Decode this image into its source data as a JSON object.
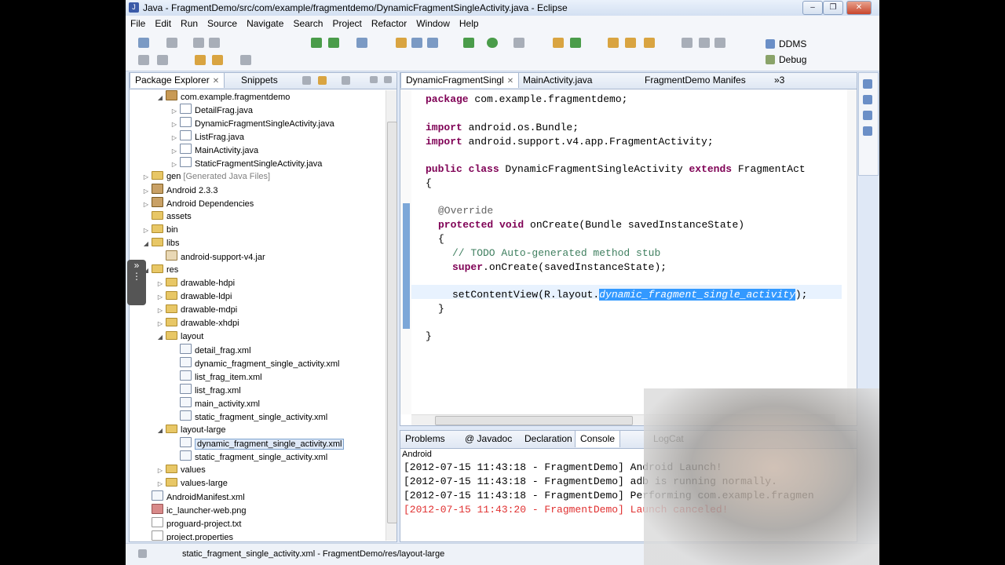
{
  "window": {
    "title": "Java - FragmentDemo/src/com/example/fragmentdemo/DynamicFragmentSingleActivity.java - Eclipse"
  },
  "menu": [
    "File",
    "Edit",
    "Run",
    "Source",
    "Navigate",
    "Search",
    "Project",
    "Refactor",
    "Window",
    "Help"
  ],
  "perspectives": {
    "ddms": "DDMS",
    "debug": "Debug"
  },
  "package_explorer": {
    "tab_label": "Package Explorer",
    "snippets_label": "Snippets",
    "tree": [
      {
        "label": "com.example.fragmentdemo",
        "type": "pkg",
        "arrow": "open",
        "depth": 2
      },
      {
        "label": "DetailFrag.java",
        "type": "java",
        "arrow": "closed",
        "depth": 3
      },
      {
        "label": "DynamicFragmentSingleActivity.java",
        "type": "java",
        "arrow": "closed",
        "depth": 3
      },
      {
        "label": "ListFrag.java",
        "type": "java",
        "arrow": "closed",
        "depth": 3
      },
      {
        "label": "MainActivity.java",
        "type": "java",
        "arrow": "closed",
        "depth": 3
      },
      {
        "label": "StaticFragmentSingleActivity.java",
        "type": "java",
        "arrow": "closed",
        "depth": 3
      },
      {
        "label": "gen",
        "extra": "[Generated Java Files]",
        "type": "folder",
        "arrow": "closed",
        "depth": 1
      },
      {
        "label": "Android 2.3.3",
        "type": "lib",
        "arrow": "closed",
        "depth": 1
      },
      {
        "label": "Android Dependencies",
        "type": "lib",
        "arrow": "closed",
        "depth": 1
      },
      {
        "label": "assets",
        "type": "folder",
        "arrow": "none",
        "depth": 1
      },
      {
        "label": "bin",
        "type": "folder",
        "arrow": "closed",
        "depth": 1
      },
      {
        "label": "libs",
        "type": "folder",
        "arrow": "open",
        "depth": 1
      },
      {
        "label": "android-support-v4.jar",
        "type": "jar",
        "arrow": "none",
        "depth": 2
      },
      {
        "label": "res",
        "type": "folder",
        "arrow": "open",
        "depth": 1
      },
      {
        "label": "drawable-hdpi",
        "type": "folder",
        "arrow": "closed",
        "depth": 2
      },
      {
        "label": "drawable-ldpi",
        "type": "folder",
        "arrow": "closed",
        "depth": 2
      },
      {
        "label": "drawable-mdpi",
        "type": "folder",
        "arrow": "closed",
        "depth": 2
      },
      {
        "label": "drawable-xhdpi",
        "type": "folder",
        "arrow": "closed",
        "depth": 2
      },
      {
        "label": "layout",
        "type": "folder",
        "arrow": "open",
        "depth": 2
      },
      {
        "label": "detail_frag.xml",
        "type": "xml",
        "arrow": "none",
        "depth": 3
      },
      {
        "label": "dynamic_fragment_single_activity.xml",
        "type": "xml",
        "arrow": "none",
        "depth": 3
      },
      {
        "label": "list_frag_item.xml",
        "type": "xml",
        "arrow": "none",
        "depth": 3
      },
      {
        "label": "list_frag.xml",
        "type": "xml",
        "arrow": "none",
        "depth": 3
      },
      {
        "label": "main_activity.xml",
        "type": "xml",
        "arrow": "none",
        "depth": 3
      },
      {
        "label": "static_fragment_single_activity.xml",
        "type": "xml",
        "arrow": "none",
        "depth": 3
      },
      {
        "label": "layout-large",
        "type": "folder",
        "arrow": "open",
        "depth": 2
      },
      {
        "label": "dynamic_fragment_single_activity.xml",
        "type": "xml",
        "arrow": "none",
        "depth": 3,
        "selected": true
      },
      {
        "label": "static_fragment_single_activity.xml",
        "type": "xml",
        "arrow": "none",
        "depth": 3
      },
      {
        "label": "values",
        "type": "folder",
        "arrow": "closed",
        "depth": 2
      },
      {
        "label": "values-large",
        "type": "folder",
        "arrow": "closed",
        "depth": 2
      },
      {
        "label": "AndroidManifest.xml",
        "type": "xml",
        "arrow": "none",
        "depth": 1
      },
      {
        "label": "ic_launcher-web.png",
        "type": "png",
        "arrow": "none",
        "depth": 1
      },
      {
        "label": "proguard-project.txt",
        "type": "file",
        "arrow": "none",
        "depth": 1
      },
      {
        "label": "project.properties",
        "type": "file",
        "arrow": "none",
        "depth": 1
      }
    ]
  },
  "editor": {
    "tabs": [
      {
        "label": "DynamicFragmentSingl",
        "active": true,
        "close": true
      },
      {
        "label": "MainActivity.java",
        "active": false
      },
      {
        "label": "FragmentDemo Manifes",
        "active": false
      },
      {
        "label": "»3",
        "active": false
      }
    ],
    "code": {
      "l1_kw": "package",
      "l1": " com.example.fragmentdemo;",
      "l2_kw": "import",
      "l2": " android.os.Bundle;",
      "l3_kw": "import",
      "l3": " android.support.v4.app.FragmentActivity;",
      "l4_kw1": "public class",
      "l4_a": " DynamicFragmentSingleActivity ",
      "l4_kw2": "extends",
      "l4_b": " FragmentAct",
      "l5": "{",
      "l6": "@Override",
      "l7_kw": "protected void",
      "l7": " onCreate(Bundle savedInstanceState)",
      "l8": "{",
      "l9_cm": "// TODO Auto-generated method stub",
      "l10_kw": "super",
      "l10": ".onCreate(savedInstanceState);",
      "l11_a": "setContentView(R.layout.",
      "l11_hl": "dynamic_fragment_single_activity",
      "l11_b": ");",
      "l12": "}",
      "l13": "}"
    }
  },
  "console": {
    "tabs": [
      "Problems",
      "@ Javadoc",
      "Declaration",
      "Console",
      "LogCat"
    ],
    "sub": "Android",
    "lines": [
      {
        "text": "[2012-07-15 11:43:18 - FragmentDemo] Android Launch!",
        "error": false
      },
      {
        "text": "[2012-07-15 11:43:18 - FragmentDemo] adb is running normally.",
        "error": false
      },
      {
        "text": "[2012-07-15 11:43:18 - FragmentDemo] Performing com.example.fragmen",
        "error": false
      },
      {
        "text": "[2012-07-15 11:43:20 - FragmentDemo] Launch canceled!",
        "error": true
      }
    ]
  },
  "status": {
    "text": "static_fragment_single_activity.xml - FragmentDemo/res/layout-large"
  }
}
